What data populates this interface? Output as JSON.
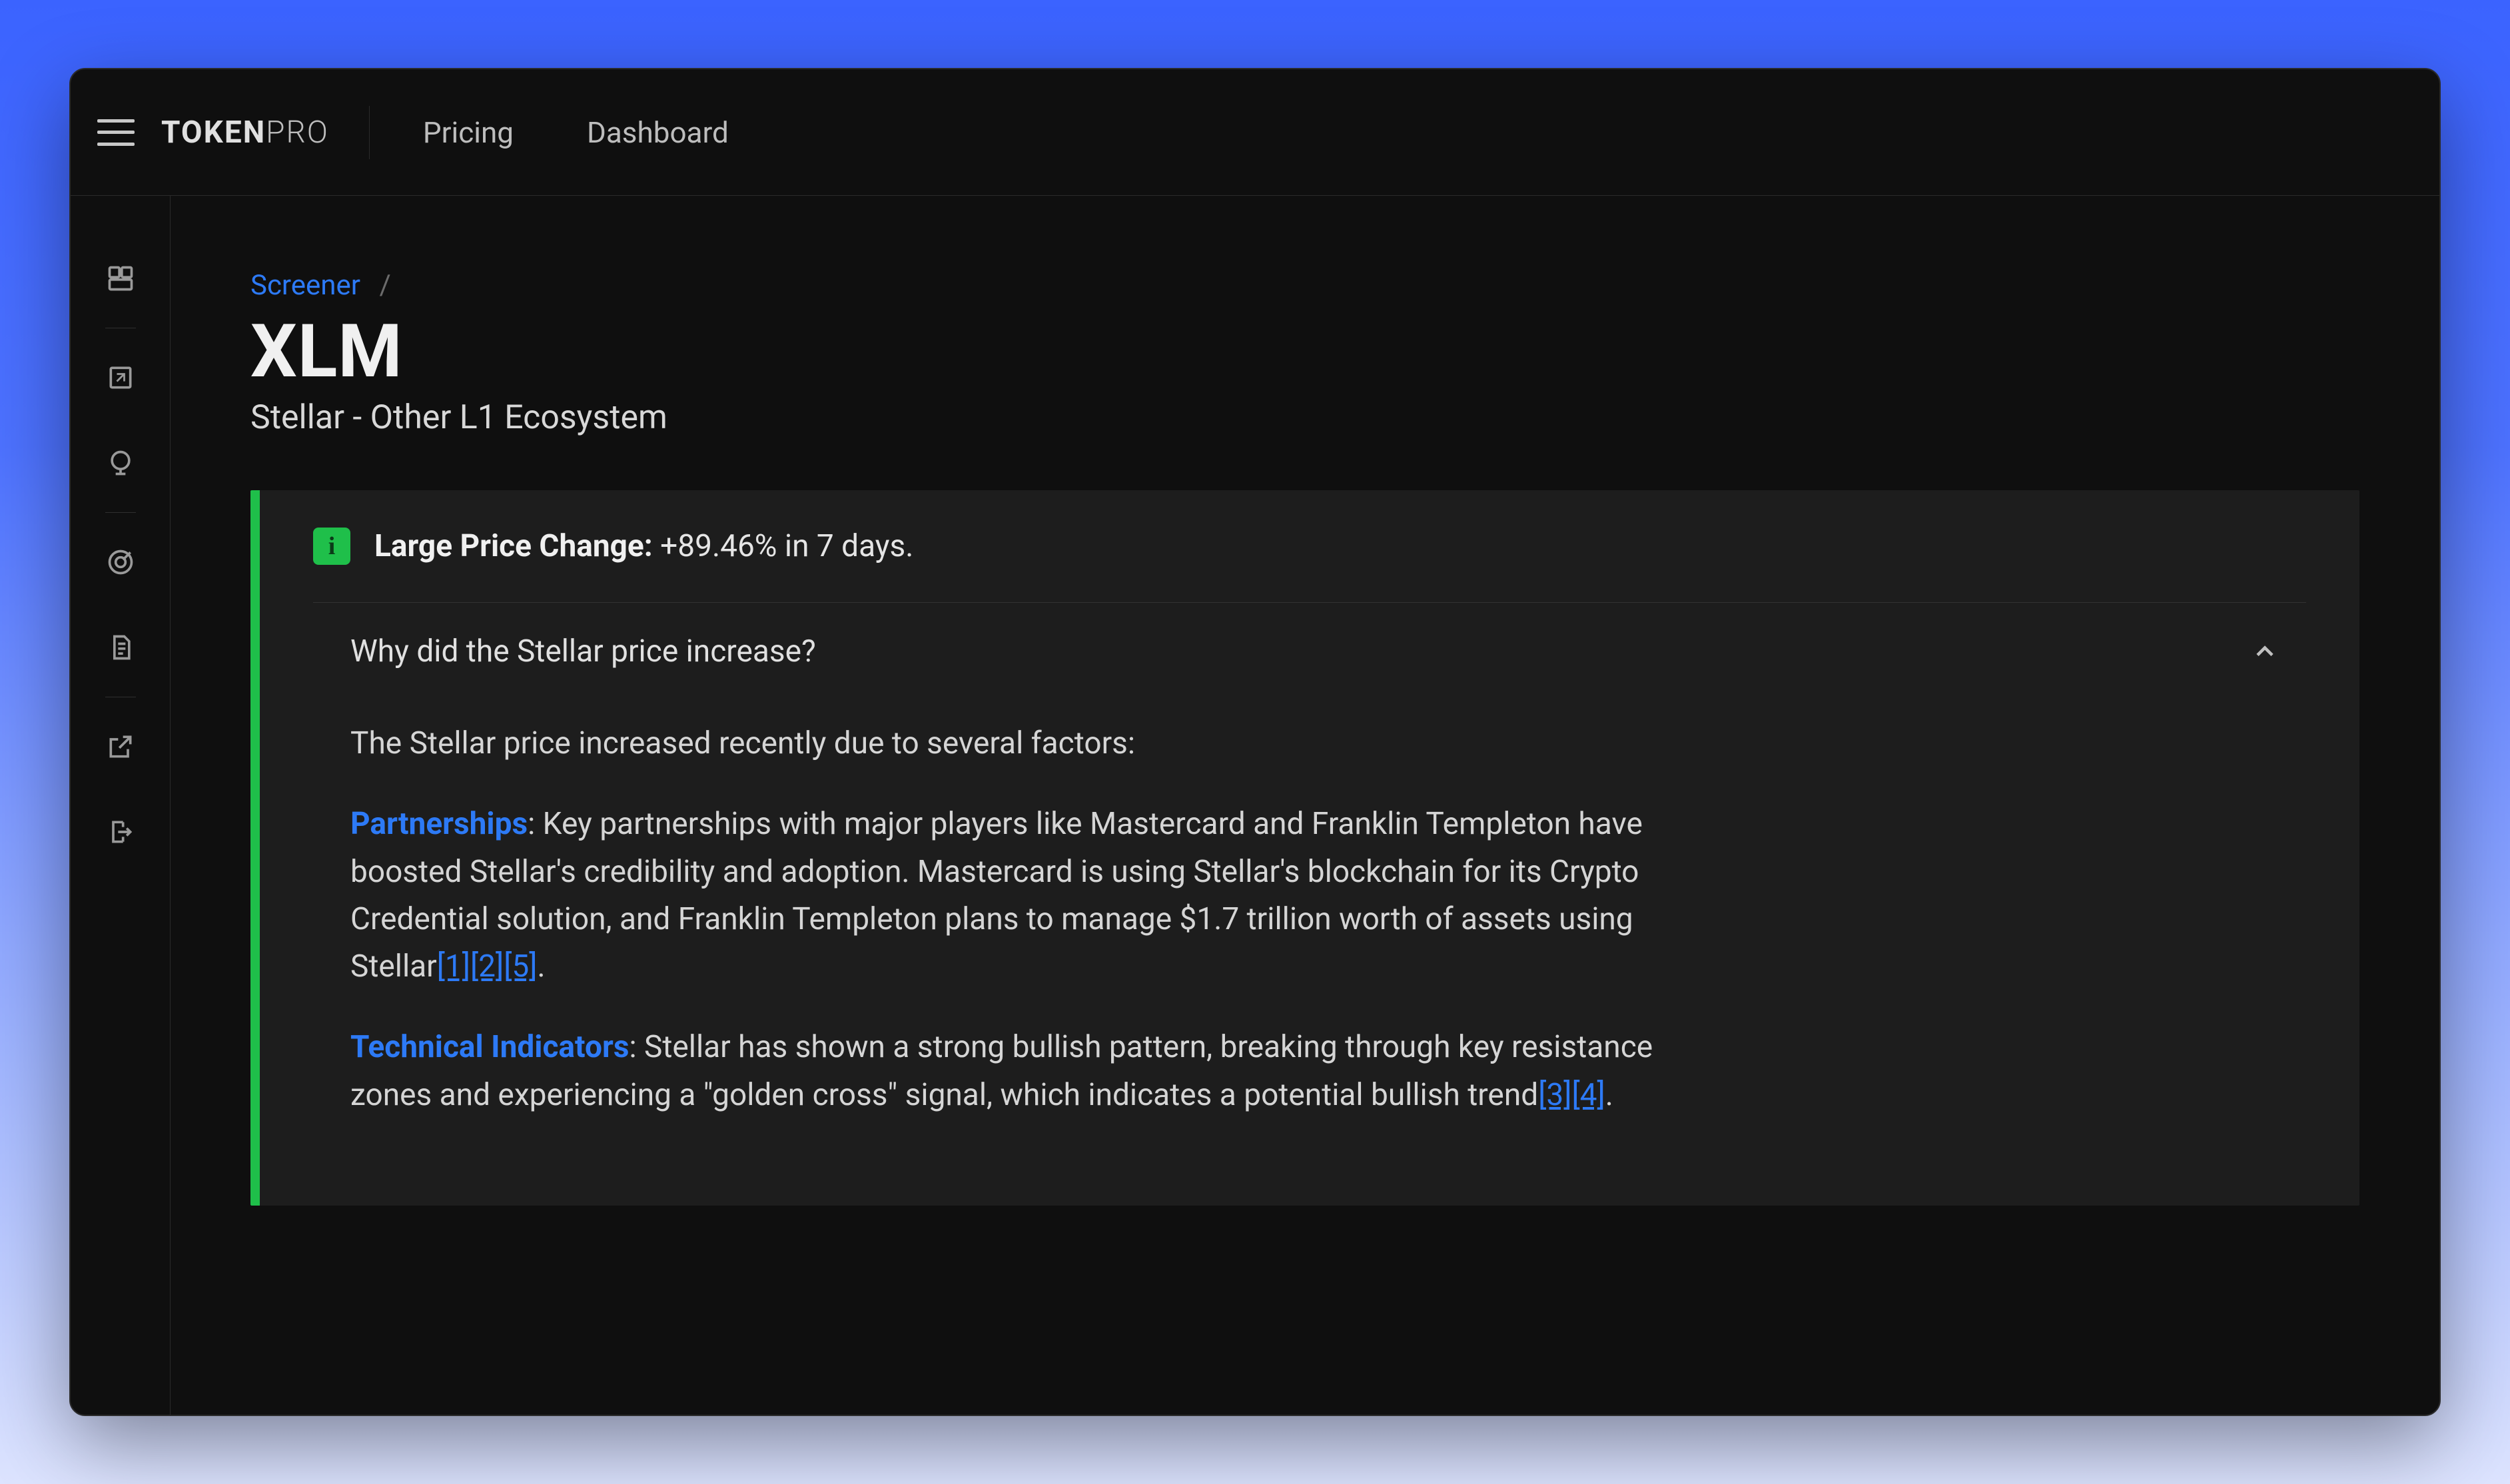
{
  "brand": {
    "part1": "TOKEN",
    "part2": "PRO"
  },
  "nav": {
    "pricing": "Pricing",
    "dashboard": "Dashboard"
  },
  "rail": {
    "dashboard": "dashboard",
    "expand": "expand",
    "globe": "globe",
    "target": "target",
    "document": "document",
    "external": "external-link",
    "logout": "logout"
  },
  "breadcrumb": {
    "screener": "Screener",
    "slash": "/"
  },
  "page": {
    "title": "XLM",
    "subtitle": "Stellar - Other L1 Ecosystem"
  },
  "alert": {
    "info_glyph": "i",
    "label": "Large Price Change:",
    "value": "+89.46% in 7 days."
  },
  "accordion": {
    "question": "Why did the Stellar price increase?",
    "intro": "The Stellar price increased recently due to several factors:",
    "p1_label": "Partnerships",
    "p1_text": ": Key partnerships with major players like Mastercard and Franklin Templeton have boosted Stellar's credibility and adoption. Mastercard is using Stellar's blockchain for its Crypto Credential solution, and Franklin Templeton plans to manage $1.7 trillion worth of assets using Stellar",
    "p1_refs": [
      "[1]",
      "[2]",
      "[5]"
    ],
    "p1_tail": ".",
    "p2_label": "Technical Indicators",
    "p2_text": ": Stellar has shown a strong bullish pattern, breaking through key resistance zones and experiencing a \"golden cross\" signal, which indicates a potential bullish trend",
    "p2_refs": [
      "[3]",
      "[4]"
    ],
    "p2_tail": "."
  }
}
